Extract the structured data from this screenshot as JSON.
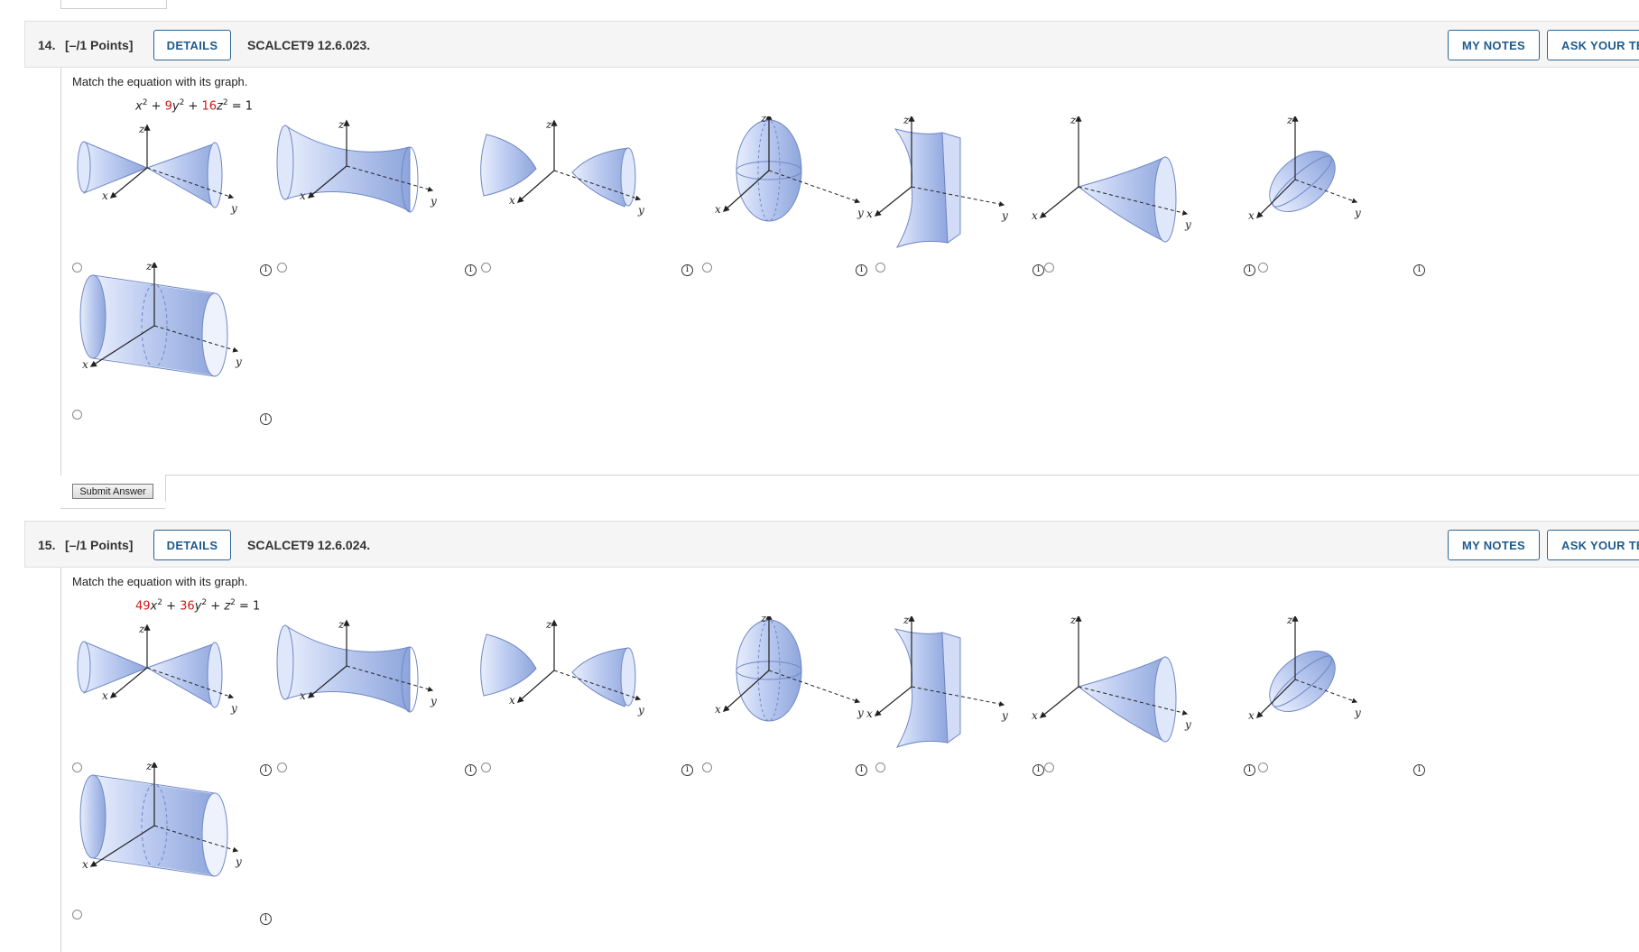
{
  "questions": [
    {
      "number": "14.",
      "points": "[–/1 Points]",
      "details_label": "DETAILS",
      "code": "SCALCET9 12.6.023.",
      "my_notes_label": "MY NOTES",
      "ask_label": "ASK YOUR TE",
      "prompt": "Match the equation with its graph.",
      "equation": [
        {
          "t": "x",
          "k": "var"
        },
        {
          "t": "2",
          "k": "sup"
        },
        {
          "t": " + ",
          "k": "op"
        },
        {
          "t": "9",
          "k": "coef"
        },
        {
          "t": "y",
          "k": "var"
        },
        {
          "t": "2",
          "k": "sup"
        },
        {
          "t": " + ",
          "k": "op"
        },
        {
          "t": "16",
          "k": "coef"
        },
        {
          "t": "z",
          "k": "var"
        },
        {
          "t": "2",
          "k": "sup"
        },
        {
          "t": " = 1",
          "k": "op"
        }
      ],
      "submit_label": "Submit Answer"
    },
    {
      "number": "15.",
      "points": "[–/1 Points]",
      "details_label": "DETAILS",
      "code": "SCALCET9 12.6.024.",
      "my_notes_label": "MY NOTES",
      "ask_label": "ASK YOUR TE",
      "prompt": "Match the equation with its graph.",
      "equation": [
        {
          "t": "49",
          "k": "coef"
        },
        {
          "t": "x",
          "k": "var"
        },
        {
          "t": "2",
          "k": "sup"
        },
        {
          "t": " + ",
          "k": "op"
        },
        {
          "t": "36",
          "k": "coef"
        },
        {
          "t": "y",
          "k": "var"
        },
        {
          "t": "2",
          "k": "sup"
        },
        {
          "t": " + ",
          "k": "op"
        },
        {
          "t": "z",
          "k": "var"
        },
        {
          "t": "2",
          "k": "sup"
        },
        {
          "t": " = 1",
          "k": "op"
        }
      ],
      "submit_label": ""
    }
  ],
  "graph_choices": [
    {
      "shape": "cone",
      "axis_labels": [
        "z",
        "x",
        "y"
      ],
      "selected": false
    },
    {
      "shape": "hyperboloid-one-sheet",
      "axis_labels": [
        "z",
        "x",
        "y"
      ],
      "selected": false
    },
    {
      "shape": "hyperboloid-two-sheets",
      "axis_labels": [
        "z",
        "x",
        "y"
      ],
      "selected": false
    },
    {
      "shape": "ellipsoid-vertical",
      "axis_labels": [
        "z",
        "x",
        "y"
      ],
      "selected": false
    },
    {
      "shape": "hyperbolic-paraboloid",
      "axis_labels": [
        "z",
        "x",
        "y"
      ],
      "selected": false
    },
    {
      "shape": "elliptic-paraboloid",
      "axis_labels": [
        "z",
        "x",
        "y"
      ],
      "selected": false
    },
    {
      "shape": "ellipsoid-tilted",
      "axis_labels": [
        "z",
        "x",
        "y"
      ],
      "selected": false
    },
    {
      "shape": "elliptic-cylinder",
      "axis_labels": [
        "z",
        "x",
        "y"
      ],
      "selected": false
    }
  ],
  "info_glyph": "i",
  "colors": {
    "accent": "#1f5b8e",
    "equation_coefficient": "#d0191a",
    "surface_fill": "#b8c8ee",
    "surface_stroke": "#6f88c4"
  }
}
